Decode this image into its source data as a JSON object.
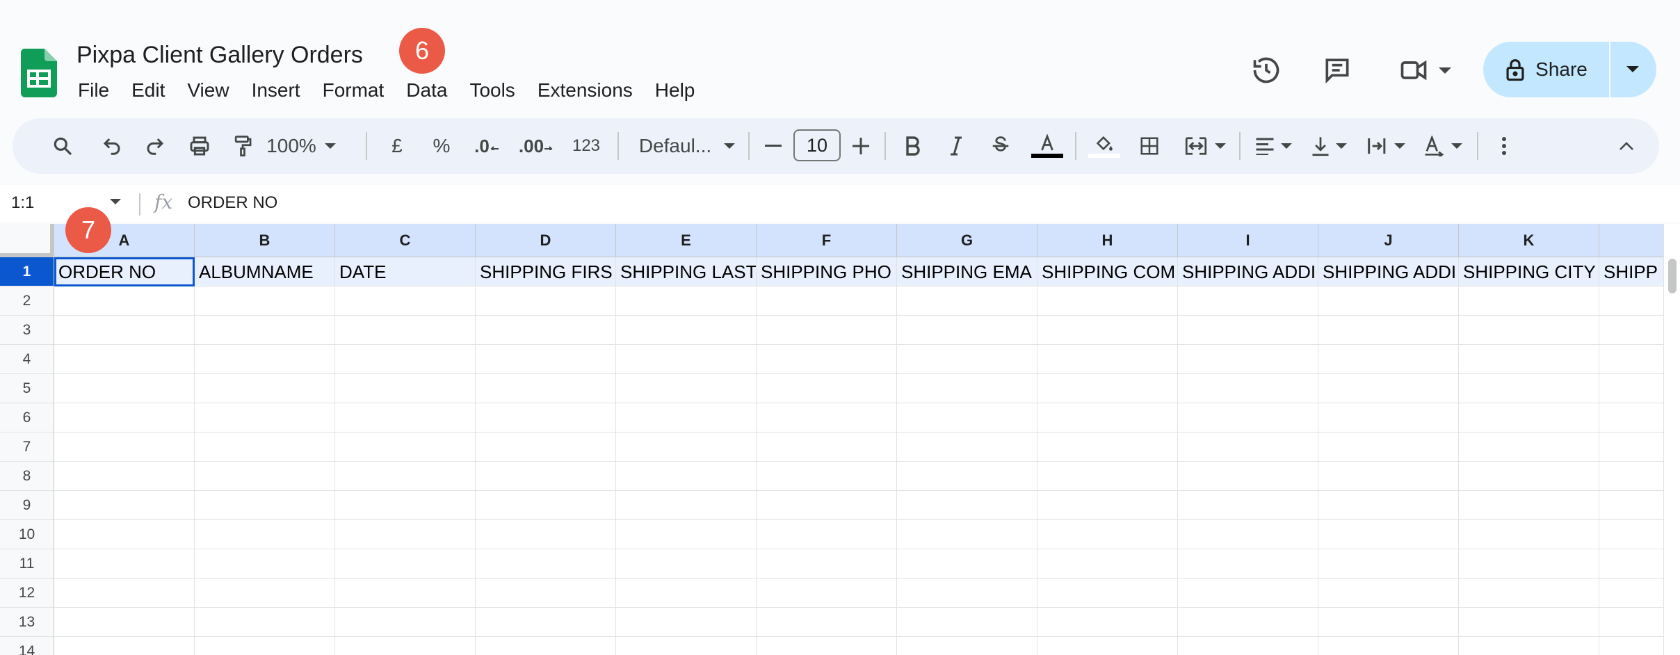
{
  "document": {
    "title": "Pixpa Client Gallery Orders",
    "menu": [
      "File",
      "Edit",
      "View",
      "Insert",
      "Format",
      "Data",
      "Tools",
      "Extensions",
      "Help"
    ]
  },
  "badges": {
    "first": "6",
    "second": "7"
  },
  "share": {
    "label": "Share"
  },
  "toolbar": {
    "zoom": "100%",
    "currency": "£",
    "percent": "%",
    "decrease_decimal": ".0",
    "increase_decimal": ".00",
    "number_format": "123",
    "font": "Defaul...",
    "font_size": "10"
  },
  "formula_bar": {
    "cell_ref": "1:1",
    "fx": "fx",
    "content": "ORDER NO"
  },
  "sheet": {
    "columns": [
      "A",
      "B",
      "C",
      "D",
      "E",
      "F",
      "G",
      "H",
      "I",
      "J",
      "K",
      ""
    ],
    "rows": [
      "1",
      "2",
      "3",
      "4",
      "5",
      "6",
      "7",
      "8",
      "9",
      "10",
      "11",
      "12",
      "13",
      "14"
    ],
    "row1_cells": [
      "ORDER NO",
      "ALBUMNAME",
      "DATE",
      "SHIPPING FIRS",
      "SHIPPING LAST",
      "SHIPPING PHO",
      "SHIPPING EMA",
      "SHIPPING COM",
      "SHIPPING ADDI",
      "SHIPPING ADDI",
      "SHIPPING CITY",
      "SHIPP"
    ]
  },
  "colors": {
    "accent": "#0b57d0",
    "header_selected": "#d3e3fd",
    "share_bg": "#c2e7ff",
    "badge": "#ea5a47",
    "logo": "#0f9d58"
  }
}
